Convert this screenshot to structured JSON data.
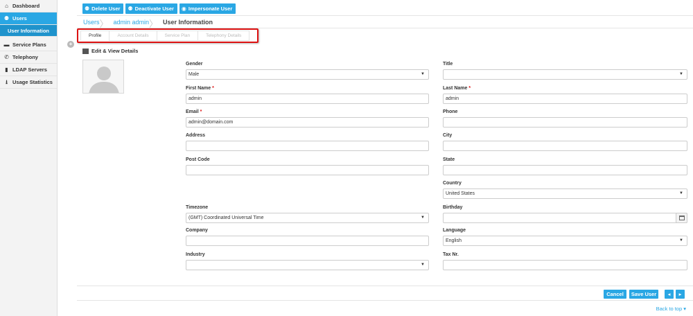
{
  "sidebar": {
    "items": [
      {
        "icon": "home-icon",
        "glyph": "⌂",
        "label": "Dashboard"
      },
      {
        "icon": "users-icon",
        "glyph": "👥",
        "label": "Users"
      },
      {
        "icon": "",
        "glyph": "",
        "label": "User Information"
      },
      {
        "icon": "briefcase-icon",
        "glyph": "▬",
        "label": "Service Plans"
      },
      {
        "icon": "phone-icon",
        "glyph": "✆",
        "label": "Telephony"
      },
      {
        "icon": "server-icon",
        "glyph": "▮",
        "label": "LDAP Servers"
      },
      {
        "icon": "download-icon",
        "glyph": "⭳",
        "label": "Usage Statistics"
      }
    ]
  },
  "toolbar": {
    "delete_label": "Delete User",
    "deactivate_label": "Deactivate User",
    "impersonate_label": "Impersonate User"
  },
  "breadcrumb": {
    "items": [
      "Users",
      "admin admin",
      "User Information"
    ]
  },
  "tabs": [
    "Profile",
    "Account Details",
    "Service Plan",
    "Telephony Details"
  ],
  "section_title": "Edit & View Details",
  "form": {
    "gender": {
      "label": "Gender",
      "value": "Male"
    },
    "title": {
      "label": "Title",
      "value": ""
    },
    "first_name": {
      "label": "First Name",
      "required": "*",
      "value": "admin"
    },
    "last_name": {
      "label": "Last Name",
      "required": "*",
      "value": "admin"
    },
    "email": {
      "label": "Email",
      "required": "*",
      "value": "admin@domain.com"
    },
    "phone": {
      "label": "Phone",
      "value": ""
    },
    "address": {
      "label": "Address",
      "value": ""
    },
    "city": {
      "label": "City",
      "value": ""
    },
    "post_code": {
      "label": "Post Code",
      "value": ""
    },
    "state": {
      "label": "State",
      "value": ""
    },
    "country": {
      "label": "Country",
      "value": "United States"
    },
    "timezone": {
      "label": "Timezone",
      "value": "(GMT) Coordinated Universal Time"
    },
    "birthday": {
      "label": "Birthday",
      "value": ""
    },
    "company": {
      "label": "Company",
      "value": ""
    },
    "language": {
      "label": "Language",
      "value": "English"
    },
    "industry": {
      "label": "Industry",
      "value": ""
    },
    "tax_nr": {
      "label": "Tax Nr.",
      "value": ""
    }
  },
  "footer": {
    "cancel_label": "Cancel",
    "save_label": "Save User",
    "prev_glyph": "◂",
    "next_glyph": "▸",
    "back_to_top": "Back to top ▾"
  },
  "colors": {
    "accent": "#2aa7e4",
    "highlight_border": "#dd1111"
  }
}
